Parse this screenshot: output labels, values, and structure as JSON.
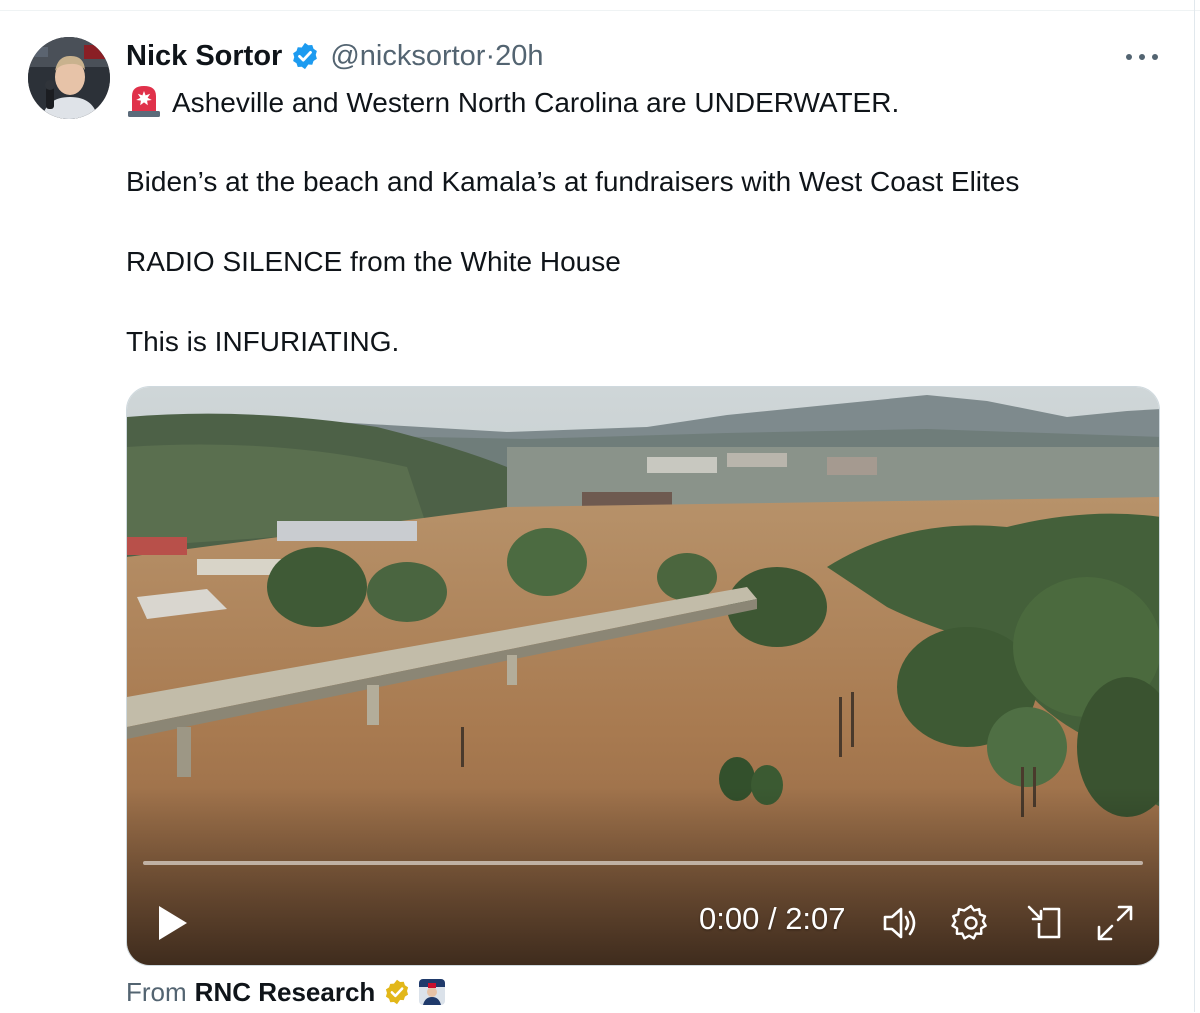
{
  "tweet": {
    "author_name": "Nick Sortor",
    "handle": "@nicksortor",
    "separator": " · ",
    "time_ago": "20h",
    "lines": [
      "Asheville and Western North Carolina are UNDERWATER.",
      "Biden’s at the beach and Kamala’s at fundraisers with West Coast Elites",
      "RADIO SILENCE from the White House",
      "This is INFURIATING."
    ]
  },
  "video": {
    "current_time": "0:00",
    "time_separator": " / ",
    "duration": "2:07",
    "progress": 0.0
  },
  "source": {
    "from_label": "From",
    "org_name": "RNC Research"
  },
  "colors": {
    "verified_blue": "#1d9bf0",
    "gold_badge": "#e2b719",
    "text_primary": "#0f1419",
    "text_secondary": "#536471",
    "flood_water": "#a87a50"
  },
  "icons": {
    "verified": "verified-badge-icon",
    "more": "more-options-icon",
    "siren": "rotating-light-emoji-icon",
    "play": "play-icon",
    "volume": "volume-icon",
    "settings": "settings-gear-icon",
    "minimize": "picture-in-picture-icon",
    "fullscreen": "fullscreen-icon",
    "gold_check": "gold-verified-badge-icon"
  }
}
